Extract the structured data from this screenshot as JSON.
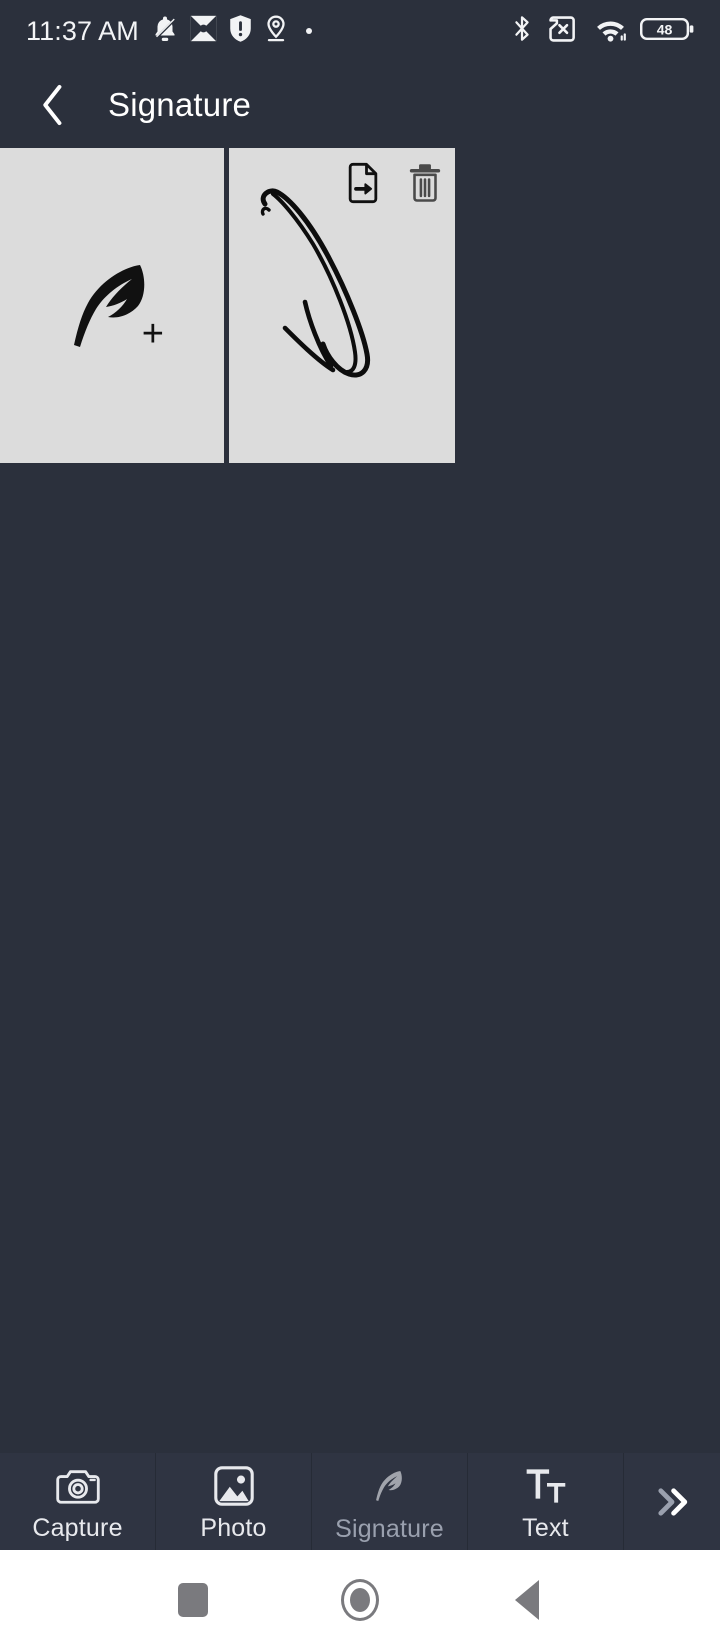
{
  "status_bar": {
    "time": "11:37 AM",
    "left_icons": [
      {
        "name": "bell-muted-icon"
      },
      {
        "name": "app-diamond-icon"
      },
      {
        "name": "shield-alert-icon"
      },
      {
        "name": "location-pin-icon"
      },
      {
        "name": "dot-icon"
      }
    ],
    "right_icons": [
      {
        "name": "bluetooth-icon"
      },
      {
        "name": "sim-card-off-icon"
      },
      {
        "name": "wifi-icon"
      }
    ],
    "battery_percent": "48"
  },
  "app_bar": {
    "back_label": "‹",
    "title": "Signature"
  },
  "signature_cards": [
    {
      "name": "add-signature-card",
      "type": "add",
      "icon": "quill-plus-icon",
      "plus": "+"
    },
    {
      "name": "signature-card",
      "type": "saved",
      "icon": "handwritten-signature",
      "actions": [
        {
          "name": "export-signature-button",
          "icon": "file-export-icon"
        },
        {
          "name": "delete-signature-button",
          "icon": "trash-icon"
        }
      ]
    }
  ],
  "toolbar": {
    "items": [
      {
        "label": "Capture",
        "icon": "camera-icon",
        "active": false
      },
      {
        "label": "Photo",
        "icon": "image-icon",
        "active": false
      },
      {
        "label": "Signature",
        "icon": "quill-icon",
        "active": true
      },
      {
        "label": "Text",
        "icon": "text-format-icon",
        "active": false
      }
    ],
    "more": {
      "name": "more-chevron-icon",
      "label": "»"
    }
  },
  "nav_bar": {
    "buttons": [
      {
        "name": "recents-button",
        "icon": "square-icon"
      },
      {
        "name": "home-button",
        "icon": "circle-icon"
      },
      {
        "name": "back-button",
        "icon": "triangle-icon"
      }
    ]
  },
  "colors": {
    "background": "#2b303c",
    "toolbar_bg": "#2f3442",
    "card_bg": "#dcdcdc",
    "text": "#ffffff",
    "nav_bg": "#ffffff",
    "nav_icon": "#7a7a7e"
  }
}
